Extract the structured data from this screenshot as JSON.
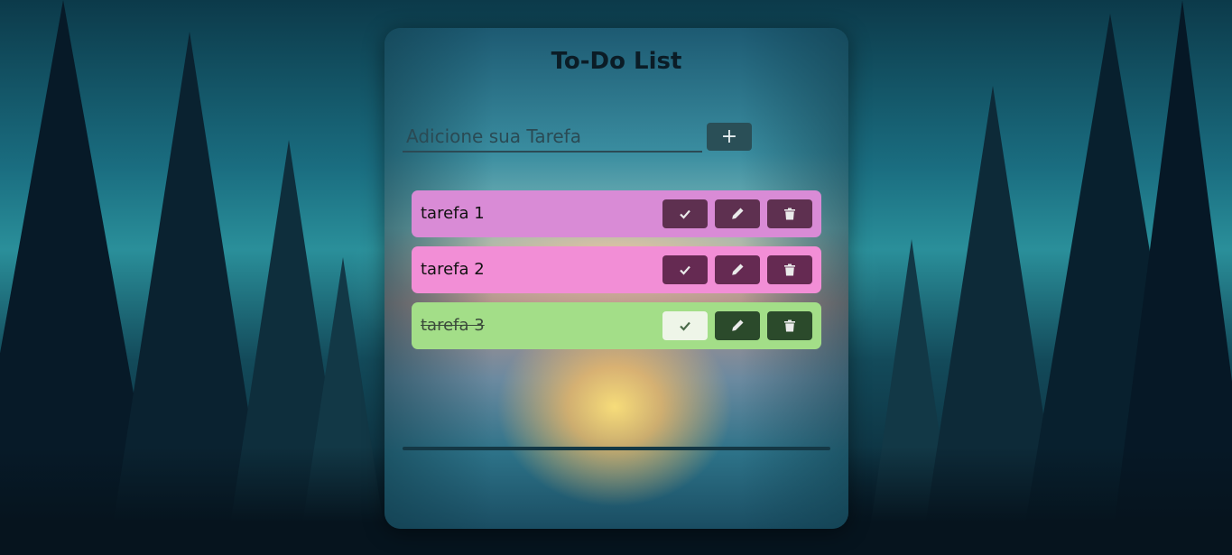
{
  "app": {
    "title": "To-Do List"
  },
  "add_form": {
    "placeholder": "Adicione sua Tarefa",
    "value": "",
    "add_button_label": "+"
  },
  "tasks": [
    {
      "text": "tarefa 1",
      "done": false,
      "color": "#d98bd6",
      "button_color": "#5e3050",
      "check_color": "#5e3050"
    },
    {
      "text": "tarefa 2",
      "done": false,
      "color": "#f28ed6",
      "button_color": "#652a52",
      "check_color": "#652a52"
    },
    {
      "text": "tarefa 3",
      "done": true,
      "color": "#a3de88",
      "button_color": "#2b4a2b",
      "check_color": "#eef5e8"
    }
  ],
  "icons": {
    "check": "check-icon",
    "edit": "pencil-icon",
    "delete": "trash-icon"
  }
}
